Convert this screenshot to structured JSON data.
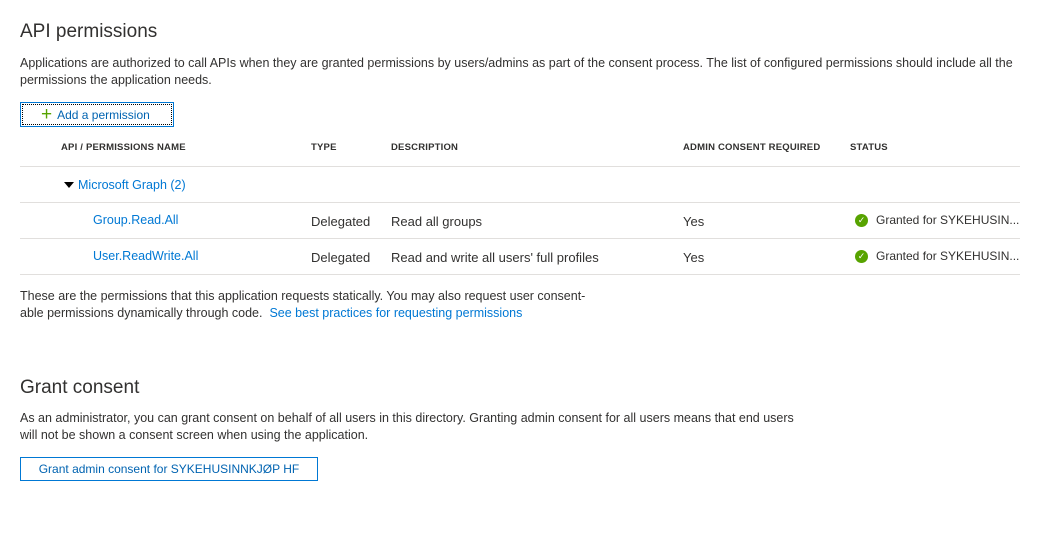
{
  "api_permissions": {
    "title": "API permissions",
    "description": "Applications are authorized to call APIs when they are granted permissions by users/admins as part of the consent process. The list of configured permissions should include all the permissions the application needs.",
    "add_button_label": "Add a permission",
    "add_button_icon": "plus-icon"
  },
  "table": {
    "columns": [
      "API / PERMISSIONS NAME",
      "TYPE",
      "DESCRIPTION",
      "ADMIN CONSENT REQUIRED",
      "STATUS"
    ],
    "group": {
      "label": "Microsoft Graph (2)",
      "icon": "caret-down-icon"
    },
    "rows": [
      {
        "name": "Group.Read.All",
        "type": "Delegated",
        "description": "Read all groups",
        "admin_consent": "Yes",
        "status": "Granted for SYKEHUSIN..."
      },
      {
        "name": "User.ReadWrite.All",
        "type": "Delegated",
        "description": "Read and write all users' full profiles",
        "admin_consent": "Yes",
        "status": "Granted for SYKEHUSIN..."
      }
    ],
    "status_icon": "check-circle-icon",
    "status_color": "#57a300"
  },
  "footnote": {
    "text_line1": "These are the permissions that this application requests statically. You may also request user consent-",
    "text_line2": "able permissions dynamically through code.",
    "link": "See best practices for requesting permissions"
  },
  "grant_consent": {
    "title": "Grant consent",
    "description": "As an administrator, you can grant consent on behalf of all users in this directory. Granting admin consent for all users means that end users will not be shown a consent screen when using the application.",
    "button_label": "Grant admin consent for SYKEHUSINNKJØP HF"
  },
  "colors": {
    "accent": "#0078d4",
    "success": "#57a300",
    "border": "#e1dfdd"
  }
}
